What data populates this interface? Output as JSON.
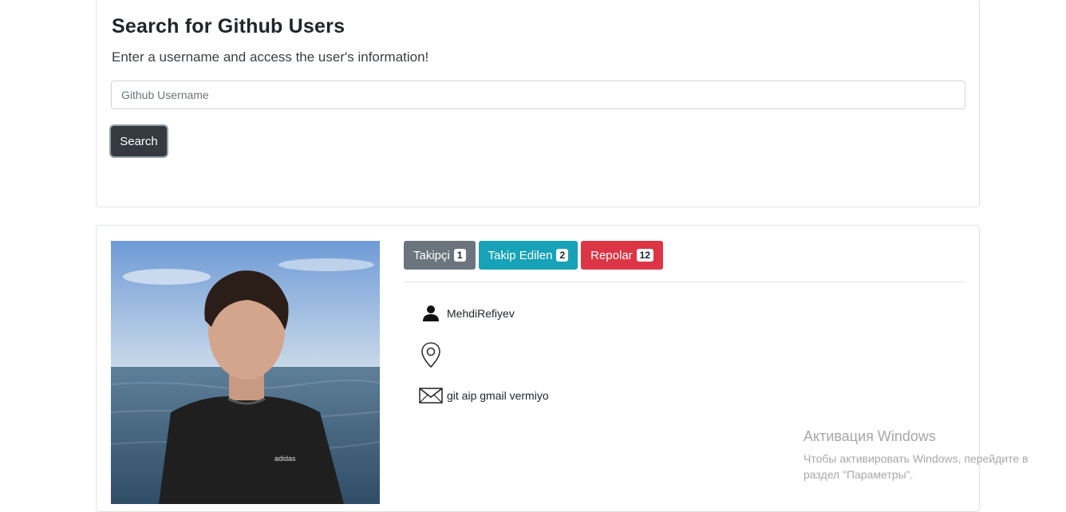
{
  "search": {
    "title": "Search for Github Users",
    "subtitle": "Enter a username and access the user's information!",
    "placeholder": "Github Username",
    "button_label": "Search"
  },
  "profile": {
    "badges": [
      {
        "label": "Takipçi",
        "count": "1",
        "color": "#6c757d"
      },
      {
        "label": "Takip Edilen",
        "count": "2",
        "color": "#17a2b8"
      },
      {
        "label": "Repolar",
        "count": "12",
        "color": "#dc3545"
      }
    ],
    "username": "MehdiRefiyev",
    "location": "",
    "email": "git aip gmail vermiyo",
    "icons": {
      "user": "person-icon",
      "location": "map-pin-icon",
      "email": "envelope-icon"
    }
  },
  "watermark": {
    "title": "Активация Windows",
    "line1": "Чтобы активировать Windows, перейдите в",
    "line2": "раздел \"Параметры\"."
  }
}
